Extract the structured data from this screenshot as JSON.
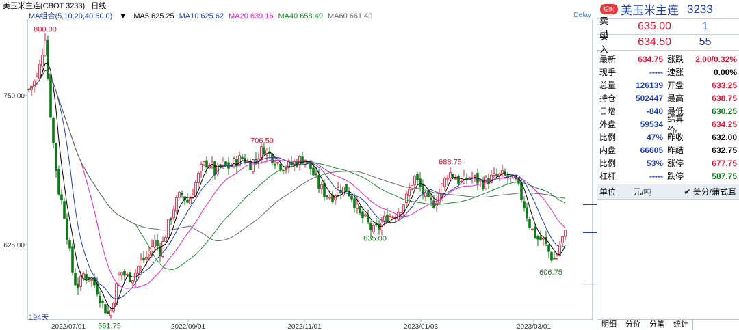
{
  "chart": {
    "symbol": "美玉米主连(CBOT 3233)",
    "period": "日线",
    "ma_group_label": "MA组合(5,10,20,40,60,0)",
    "ma": [
      {
        "label": "MA5",
        "value": "625.25",
        "color": "#000000"
      },
      {
        "label": "MA10",
        "value": "625.62",
        "color": "#1f3fa8"
      },
      {
        "label": "MA20",
        "value": "639.16",
        "color": "#e61fc8"
      },
      {
        "label": "MA40",
        "value": "658.49",
        "color": "#1a8a28"
      },
      {
        "label": "MA60",
        "value": "661.40",
        "color": "#666666"
      }
    ],
    "delay": "Delay",
    "days": "194天",
    "up_color": "#e3102f",
    "down_color": "#0d7a16"
  },
  "chart_data": {
    "type": "candlestick",
    "y_ticks": [
      750.0,
      625.0
    ],
    "ylim": [
      562,
      814
    ],
    "x_labels": [
      "2022/07/01",
      "2022/09/01",
      "2022/11/01",
      "2023/01/03",
      "2023/03/01"
    ],
    "annotations": [
      {
        "label": "800.00",
        "value": 800.0
      },
      {
        "label": "561.75",
        "value": 561.75
      },
      {
        "label": "706.50",
        "value": 706.5
      },
      {
        "label": "635.00",
        "value": 635.0
      },
      {
        "label": "688.75",
        "value": 688.75
      },
      {
        "label": "606.75",
        "value": 606.75
      }
    ],
    "series": [
      {
        "name": "MA5",
        "last": 625.25
      },
      {
        "name": "MA10",
        "last": 625.62
      },
      {
        "name": "MA20",
        "last": 639.16
      },
      {
        "name": "MA40",
        "last": 658.49
      },
      {
        "name": "MA60",
        "last": 661.4
      }
    ]
  },
  "panel": {
    "tag": "短时",
    "name": "美玉米主连",
    "code": "3233",
    "sell_label": "卖出",
    "sell_price": "635.00",
    "sell_vol": "1",
    "buy_label": "买入",
    "buy_price": "634.50",
    "buy_vol": "55",
    "stats": [
      {
        "l1": "最新",
        "v1": "634.75",
        "c1": "red",
        "l2": "涨跌",
        "v2": "2.00/0.32%",
        "c2": "red"
      },
      {
        "l1": "现手",
        "v1": "-----",
        "c1": "blue",
        "l2": "速涨",
        "v2": "0.00%",
        "c2": "black"
      },
      {
        "l1": "总量",
        "v1": "126139",
        "c1": "blue",
        "l2": "开盘",
        "v2": "633.25",
        "c2": "red"
      },
      {
        "l1": "持仓",
        "v1": "502447",
        "c1": "blue",
        "l2": "最高",
        "v2": "638.75",
        "c2": "red"
      },
      {
        "l1": "日增",
        "v1": "-840",
        "c1": "blue",
        "l2": "最低",
        "v2": "630.25",
        "c2": "green"
      },
      {
        "l1": "外盘",
        "v1": "59534",
        "c1": "blue",
        "l2": "结算价",
        "v2": "634.25",
        "c2": "red"
      },
      {
        "l1": "比例",
        "v1": "47%",
        "c1": "blue",
        "l2": "昨收",
        "v2": "632.00",
        "c2": "black"
      },
      {
        "l1": "内盘",
        "v1": "66605",
        "c1": "blue",
        "l2": "昨结",
        "v2": "632.75",
        "c2": "black"
      },
      {
        "l1": "比例",
        "v1": "53%",
        "c1": "blue",
        "l2": "涨停",
        "v2": "677.75",
        "c2": "red"
      },
      {
        "l1": "杠杆",
        "v1": "-----",
        "c1": "blue",
        "l2": "跌停",
        "v2": "587.75",
        "c2": "green"
      }
    ],
    "unit_label": "单位",
    "unit_value": "元/吨",
    "unit_select": "美分/蒲式耳",
    "tabs": [
      "明细",
      "分价",
      "分笔",
      "统计"
    ]
  }
}
